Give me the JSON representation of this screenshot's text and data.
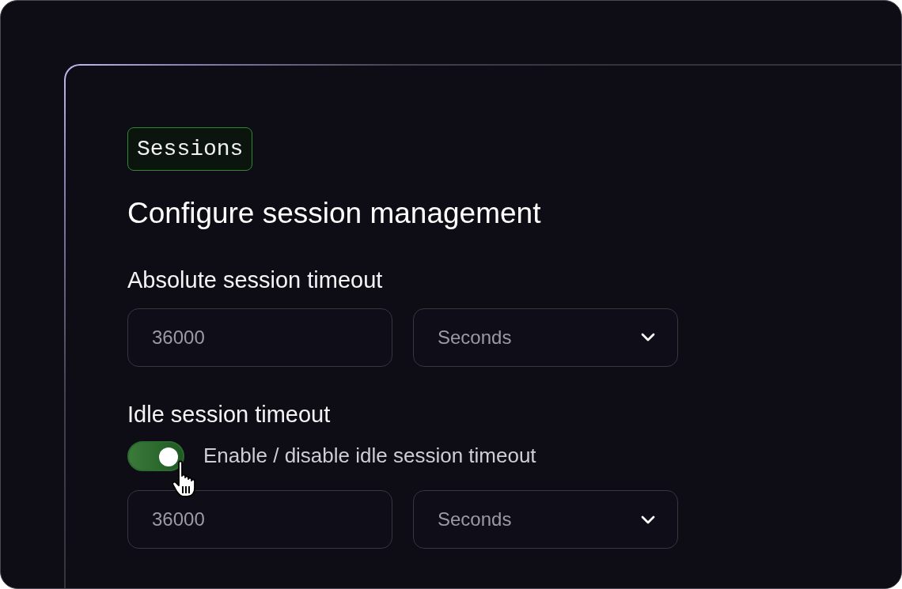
{
  "badge": "Sessions",
  "title": "Configure session management",
  "sections": [
    {
      "label": "Absolute session timeout",
      "value": "36000",
      "unit": "Seconds"
    },
    {
      "label": "Idle session timeout",
      "toggle": {
        "label": "Enable / disable idle session timeout",
        "on": true
      },
      "value": "36000",
      "unit": "Seconds"
    }
  ]
}
